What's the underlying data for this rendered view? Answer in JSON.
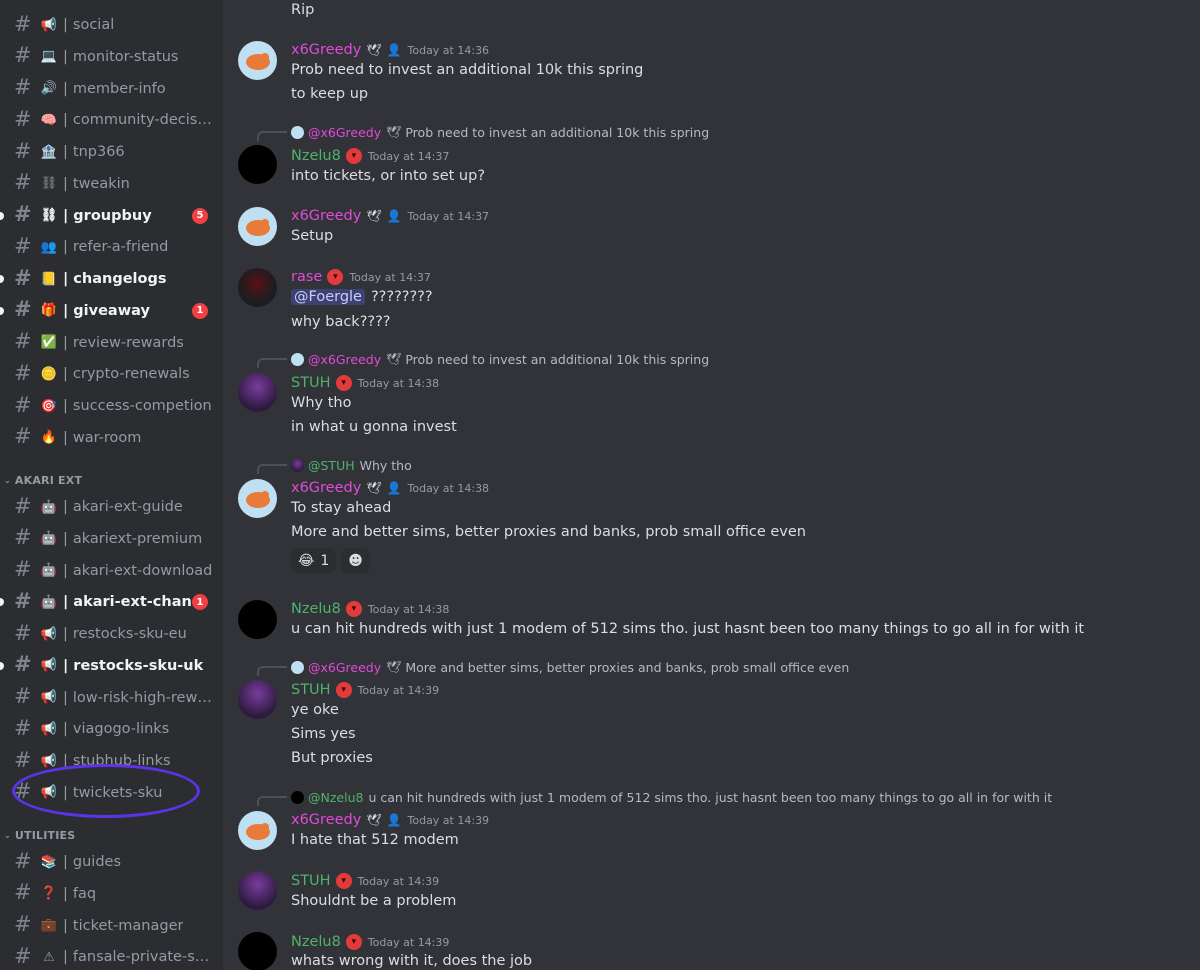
{
  "sidebar": {
    "channels_top": [
      {
        "emoji": "📢",
        "name": "social",
        "unread": false,
        "badge": ""
      },
      {
        "emoji": "💻",
        "name": "monitor-status",
        "unread": false,
        "badge": ""
      },
      {
        "emoji": "🔊",
        "name": "member-info",
        "unread": false,
        "badge": ""
      },
      {
        "emoji": "🧠",
        "name": "community-decisions",
        "unread": false,
        "badge": ""
      },
      {
        "emoji": "🏦",
        "name": "tnp366",
        "unread": false,
        "badge": ""
      },
      {
        "emoji": "⛓",
        "name": "tweakin",
        "unread": false,
        "badge": ""
      },
      {
        "emoji": "⛓",
        "name": "groupbuy",
        "unread": true,
        "badge": "5"
      },
      {
        "emoji": "👥",
        "name": "refer-a-friend",
        "unread": false,
        "badge": ""
      },
      {
        "emoji": "📒",
        "name": "changelogs",
        "unread": true,
        "badge": ""
      },
      {
        "emoji": "🎁",
        "name": "giveaway",
        "unread": true,
        "badge": "1"
      },
      {
        "emoji": "✅",
        "name": "review-rewards",
        "unread": false,
        "badge": ""
      },
      {
        "emoji": "🪙",
        "name": "crypto-renewals",
        "unread": false,
        "badge": ""
      },
      {
        "emoji": "🎯",
        "name": "success-competion",
        "unread": false,
        "badge": ""
      },
      {
        "emoji": "🔥",
        "name": "war-room",
        "unread": false,
        "badge": ""
      }
    ],
    "category_akari": "AKARI EXT",
    "channels_akari": [
      {
        "emoji": "🤖",
        "name": "akari-ext-guide",
        "unread": false,
        "badge": ""
      },
      {
        "emoji": "🤖",
        "name": "akariext-premium",
        "unread": false,
        "badge": ""
      },
      {
        "emoji": "🤖",
        "name": "akari-ext-download",
        "unread": false,
        "badge": ""
      },
      {
        "emoji": "🤖",
        "name": "akari-ext-chang...",
        "unread": true,
        "badge": "1"
      },
      {
        "emoji": "📢",
        "name": "restocks-sku-eu",
        "unread": false,
        "badge": ""
      },
      {
        "emoji": "📢",
        "name": "restocks-sku-uk",
        "unread": true,
        "badge": ""
      },
      {
        "emoji": "📢",
        "name": "low-risk-high-rewar...",
        "unread": false,
        "badge": ""
      },
      {
        "emoji": "📢",
        "name": "viagogo-links",
        "unread": false,
        "badge": ""
      },
      {
        "emoji": "📢",
        "name": "stubhub-links",
        "unread": false,
        "badge": ""
      },
      {
        "emoji": "📢",
        "name": "twickets-sku",
        "unread": false,
        "badge": ""
      }
    ],
    "category_utilities": "UTILITIES",
    "channels_utilities": [
      {
        "emoji": "📚",
        "name": "guides",
        "unread": false,
        "badge": ""
      },
      {
        "emoji": "❓",
        "name": "faq",
        "unread": false,
        "badge": ""
      },
      {
        "emoji": "💼",
        "name": "ticket-manager",
        "unread": false,
        "badge": ""
      },
      {
        "emoji": "⚠",
        "name": "fansale-private-sal...",
        "unread": false,
        "badge": ""
      }
    ],
    "icons": {
      "hash": "#",
      "separator": "|",
      "chevron": "⌄"
    }
  },
  "colors": {
    "greedy": "#e14bd6",
    "green": "#4fb36b",
    "rase": "#e14bd6",
    "circle": "#5b34e8"
  },
  "chat": {
    "m0": {
      "line1": "Rip"
    },
    "m1": {
      "user": "x6Greedy",
      "time": "Today at 14:36",
      "line1": "Prob need to invest an additional 10k this spring",
      "line2": "to keep up"
    },
    "m2": {
      "reply_to": "@x6Greedy",
      "reply_text": "Prob need to invest an additional 10k this spring",
      "user": "Nzelu8",
      "time": "Today at 14:37",
      "line1": "into tickets, or into set up?"
    },
    "m3": {
      "user": "x6Greedy",
      "time": "Today at 14:37",
      "line1": "Setup"
    },
    "m4": {
      "user": "rase",
      "time": "Today at 14:37",
      "mention": "@Foergle",
      "line1": "????????",
      "line2": "why back????"
    },
    "m5": {
      "reply_to": "@x6Greedy",
      "reply_text": "Prob need to invest an additional 10k this spring",
      "user": "STUH",
      "time": "Today at 14:38",
      "line1": "Why tho",
      "line2": "in what u gonna invest"
    },
    "m6": {
      "reply_to": "@STUH",
      "reply_text": "Why tho",
      "user": "x6Greedy",
      "time": "Today at 14:38",
      "line1": "To stay ahead",
      "line2": "More and better sims, better proxies and banks, prob small office even",
      "reaction_emoji": "😂",
      "reaction_count": "1",
      "add_reaction": "☻"
    },
    "m7": {
      "user": "Nzelu8",
      "time": "Today at 14:38",
      "line1": "u can hit hundreds with just 1 modem of 512 sims tho. just hasnt been too many things to go all in for with it"
    },
    "m8": {
      "reply_to": "@x6Greedy",
      "reply_text": "More and better sims, better proxies and banks, prob small office even",
      "user": "STUH",
      "time": "Today at 14:39",
      "line1": "ye oke",
      "line2": "Sims yes",
      "line3": "But proxies"
    },
    "m9": {
      "reply_to": "@Nzelu8",
      "reply_text": "u can hit hundreds with just 1 modem of 512 sims tho. just hasnt been too many things to go all in for with it",
      "user": "x6Greedy",
      "time": "Today at 14:39",
      "line1": "I hate that 512 modem"
    },
    "m10": {
      "user": "STUH",
      "time": "Today at 14:39",
      "line1": "Shouldnt be a problem"
    },
    "m11": {
      "user": "Nzelu8",
      "time": "Today at 14:39",
      "line1": "whats wrong with it, does the job"
    }
  }
}
